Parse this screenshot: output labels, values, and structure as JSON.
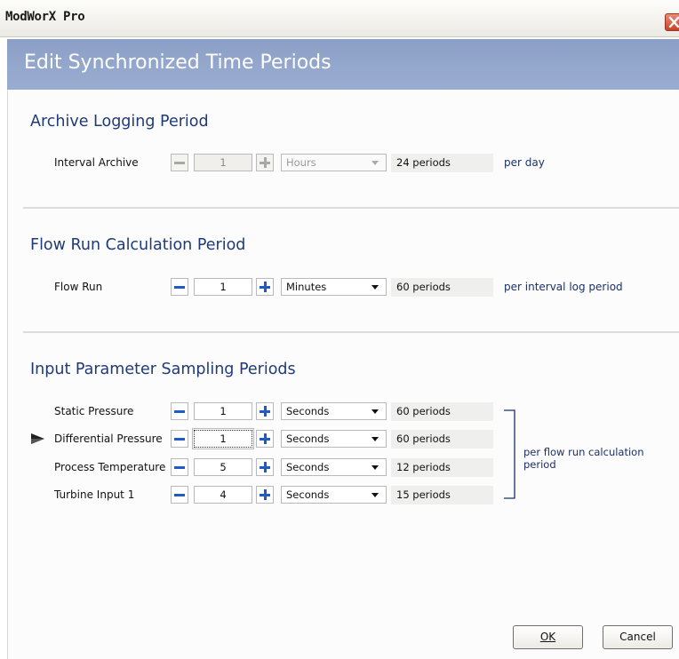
{
  "window": {
    "title": "ModWorX Pro"
  },
  "header": {
    "title": "Edit Synchronized Time Periods"
  },
  "sections": {
    "archive": {
      "title": "Archive Logging Period",
      "row": {
        "label": "Interval Archive",
        "value": "1",
        "unit": "Hours",
        "periods": "24 periods",
        "per": "per day",
        "enabled": false
      }
    },
    "flow": {
      "title": "Flow Run Calculation Period",
      "row": {
        "label": "Flow Run",
        "value": "1",
        "unit": "Minutes",
        "periods": "60 periods",
        "per": "per interval log period",
        "enabled": true
      }
    },
    "input": {
      "title": "Input Parameter Sampling Periods",
      "rows": [
        {
          "label": "Static Pressure",
          "value": "1",
          "unit": "Seconds",
          "periods": "60 periods"
        },
        {
          "label": "Differential Pressure",
          "value": "1",
          "unit": "Seconds",
          "periods": "60 periods",
          "selected": true
        },
        {
          "label": "Process Temperature",
          "value": "5",
          "unit": "Seconds",
          "periods": "12 periods"
        },
        {
          "label": "Turbine Input 1",
          "value": "4",
          "unit": "Seconds",
          "periods": "15 periods"
        }
      ],
      "per": "per flow run calculation period"
    }
  },
  "buttons": {
    "ok": "OK",
    "cancel": "Cancel"
  },
  "colors": {
    "header_bg": "#8c9fc6",
    "section_title": "#1f3a78",
    "spin_accent": "#1e5bc6"
  }
}
